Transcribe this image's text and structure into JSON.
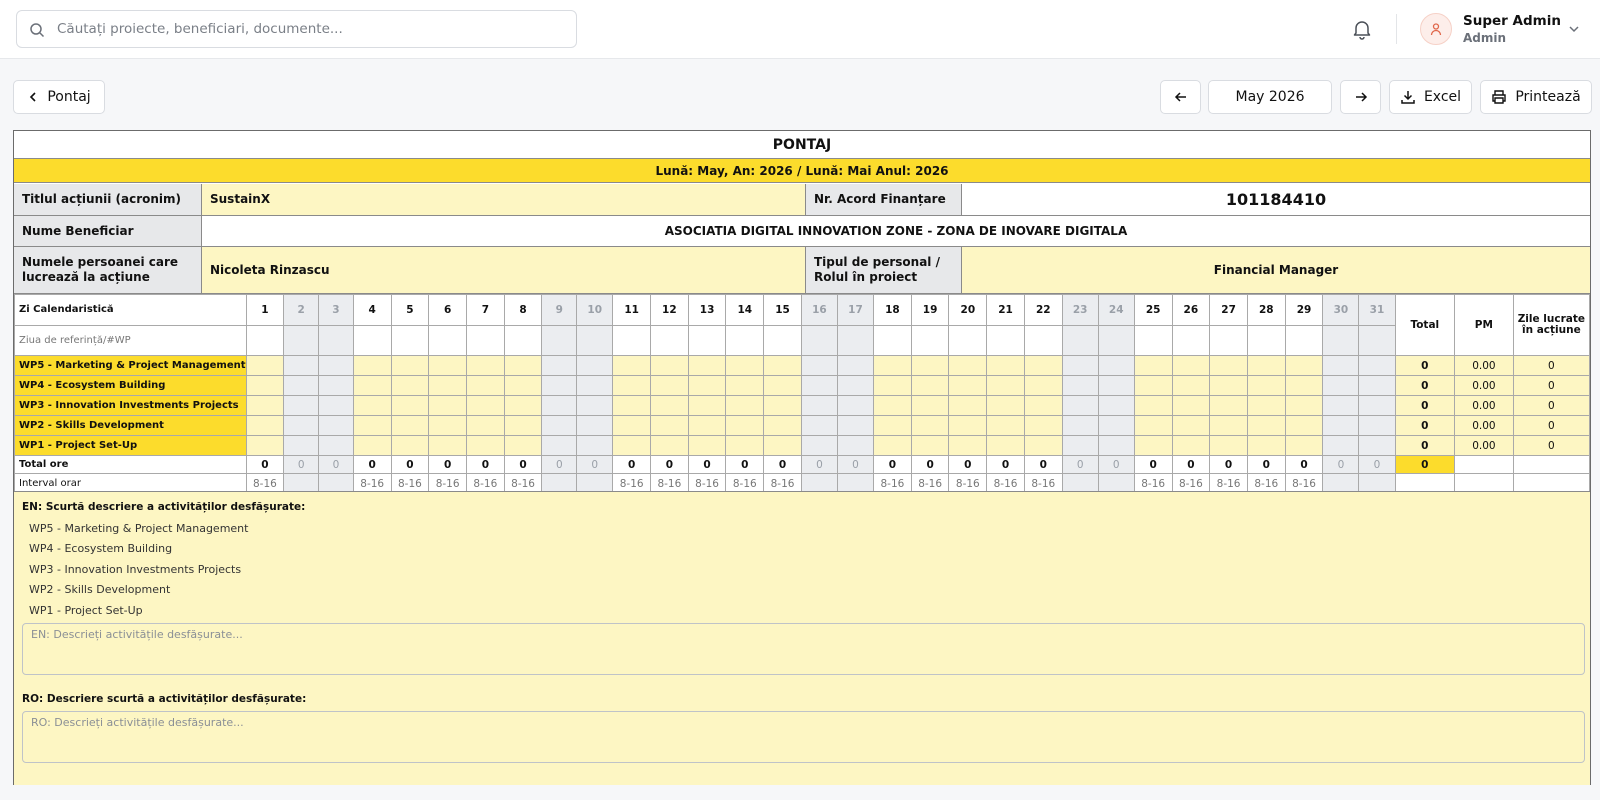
{
  "search": {
    "placeholder": "Căutați proiecte, beneficiari, documente..."
  },
  "user": {
    "name": "Super Admin",
    "role": "Admin"
  },
  "toolbar": {
    "back_label": "Pontaj",
    "month": "May 2026",
    "excel_label": "Excel",
    "print_label": "Printează"
  },
  "sheet": {
    "title": "PONTAJ",
    "month_line": "Lună: May, An: 2026 / Lună: Mai Anul: 2026",
    "action_title_label": "Titlul acțiunii (acronim)",
    "action_title_value": "SustainX",
    "agreement_label": "Nr. Acord Finanțare",
    "agreement_value": "101184410",
    "beneficiary_label": "Nume Beneficiar",
    "beneficiary_value": "ASOCIATIA DIGITAL INNOVATION ZONE - ZONA DE INOVARE DIGITALA",
    "person_label": "Numele persoanei care lucrează la acțiune",
    "person_value": "Nicoleta Rinzascu",
    "role_label": "Tipul de personal / Rolul în proiect",
    "role_value": "Financial Manager"
  },
  "grid": {
    "day_header": "Zi Calendaristică",
    "ref_label": "Ziua de referință/#WP",
    "total_header": "Total",
    "pm_header": "PM",
    "days_worked_header": "Zile lucrate în acțiune",
    "days": [
      "1",
      "2",
      "3",
      "4",
      "5",
      "6",
      "7",
      "8",
      "9",
      "10",
      "11",
      "12",
      "13",
      "14",
      "15",
      "16",
      "17",
      "18",
      "19",
      "20",
      "21",
      "22",
      "23",
      "24",
      "25",
      "26",
      "27",
      "28",
      "29",
      "30",
      "31"
    ],
    "weekend": [
      2,
      3,
      9,
      10,
      16,
      17,
      23,
      24,
      30,
      31
    ],
    "wp_rows": [
      {
        "label": "WP5 - Marketing & Project Management",
        "total": "0",
        "pm": "0.00",
        "days": "0"
      },
      {
        "label": "WP4 - Ecosystem Building",
        "total": "0",
        "pm": "0.00",
        "days": "0"
      },
      {
        "label": "WP3 - Innovation Investments Projects",
        "total": "0",
        "pm": "0.00",
        "days": "0"
      },
      {
        "label": "WP2 - Skills Development",
        "total": "0",
        "pm": "0.00",
        "days": "0"
      },
      {
        "label": "WP1 - Project Set-Up",
        "total": "0",
        "pm": "0.00",
        "days": "0"
      }
    ],
    "total_label": "Total ore",
    "total_value": "0",
    "day_total": "0",
    "interval_label": "Interval orar",
    "interval_value": "8-16"
  },
  "description": {
    "en_label": "EN: Scurtă descriere a activităților desfășurate:",
    "items": [
      "WP5 - Marketing & Project Management",
      "WP4 - Ecosystem Building",
      "WP3 - Innovation Investments Projects",
      "WP2 - Skills Development",
      "WP1 - Project Set-Up"
    ],
    "en_placeholder": "EN: Descrieți activitățile desfășurate...",
    "ro_label": "RO: Descriere scurtă a activităților desfășurate:",
    "ro_placeholder": "RO: Descrieți activitățile desfășurate..."
  }
}
